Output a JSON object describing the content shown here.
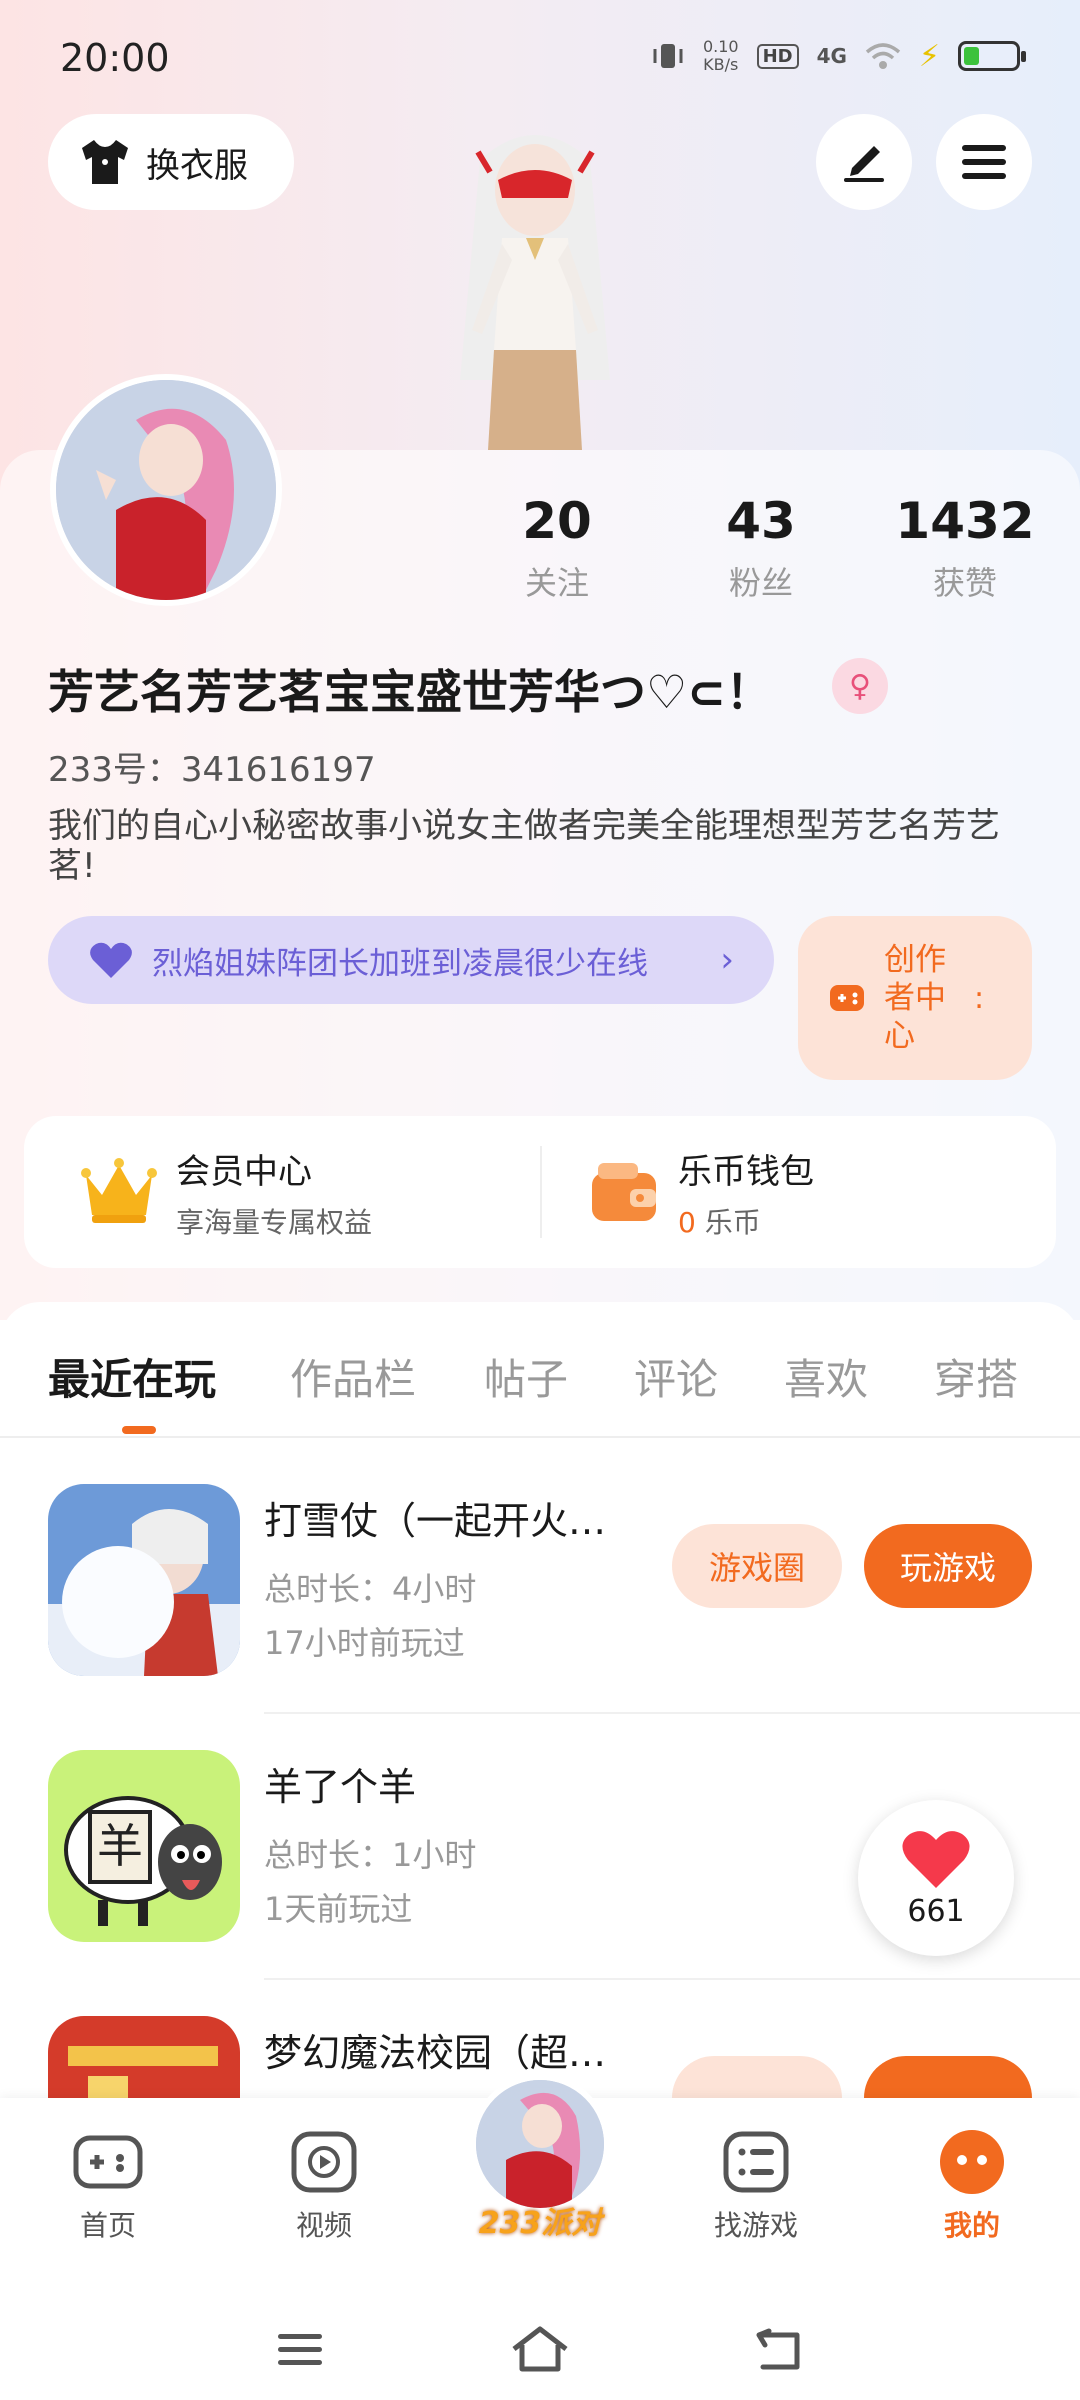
{
  "status_bar": {
    "time": "20:00",
    "net_speed_value": "0.10",
    "net_speed_unit": "KB/s",
    "hd_label": "HD",
    "network": "4G",
    "battery_level": 0.3
  },
  "header": {
    "dress_up_label": "换衣服",
    "edit_icon": "edit-icon",
    "menu_icon": "menu-icon"
  },
  "profile": {
    "stats": [
      {
        "num": "20",
        "label": "关注"
      },
      {
        "num": "43",
        "label": "粉丝"
      },
      {
        "num": "1432",
        "label": "获赞"
      }
    ],
    "nickname": "芳艺名芳艺茗宝宝盛世芳华つ♡⊂！",
    "gender_icon": "female-icon",
    "uid": "233号：341616197",
    "bio": "我们的自心小秘密故事小说女主做者完美全能理想型芳艺名芳艺茗!",
    "status_text": "烈焰姐妹阵团长加班到凌晨很少在线",
    "creator_label": "创作者中心"
  },
  "vip": {
    "member_title": "会员中心",
    "member_sub": "享海量专属权益",
    "wallet_title": "乐币钱包",
    "wallet_coin": "0",
    "wallet_unit": " 乐币"
  },
  "tabs": [
    "最近在玩",
    "作品栏",
    "帖子",
    "评论",
    "喜欢",
    "穿搭"
  ],
  "games": [
    {
      "name": "打雪仗（一起开火…",
      "duration": "总时长：4小时",
      "last_played": "17小时前玩过",
      "circle_label": "游戏圈",
      "play_label": "玩游戏"
    },
    {
      "name": "羊了个羊",
      "duration": "总时长：1小时",
      "last_played": "1天前玩过",
      "circle_label": "",
      "play_label": ""
    },
    {
      "name": "梦幻魔法校园（超…",
      "duration": "",
      "last_played": "",
      "circle_label": "",
      "play_label": ""
    }
  ],
  "like_float": {
    "count": "661"
  },
  "bottom_nav": {
    "items": [
      {
        "label": "首页",
        "icon": "gamepad-icon"
      },
      {
        "label": "视频",
        "icon": "video-icon"
      },
      {
        "label": "233派对",
        "icon": "party-avatar"
      },
      {
        "label": "找游戏",
        "icon": "list-icon"
      },
      {
        "label": "我的",
        "icon": "me-icon"
      }
    ]
  },
  "colors": {
    "accent": "#f26a1f",
    "status_purple": "#6b5fd6"
  }
}
